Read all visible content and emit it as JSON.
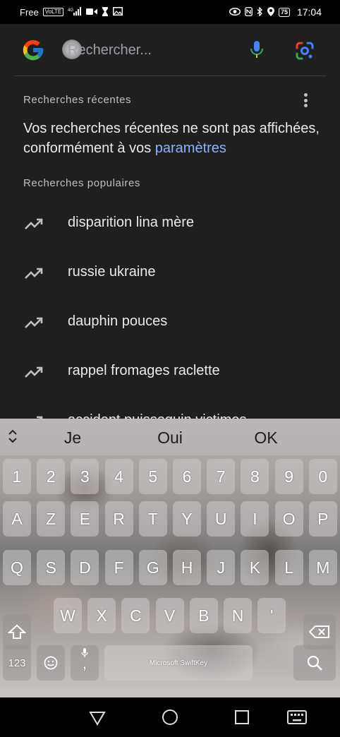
{
  "status_bar": {
    "carrier": "Free",
    "volte_badge": "VoLTE",
    "network_badge": "4G",
    "battery": "75",
    "time": "17:04"
  },
  "search": {
    "placeholder": "Rechercher..."
  },
  "recent": {
    "title": "Recherches récentes",
    "message_prefix": "Vos recherches récentes ne sont pas affichées, conformément à vos ",
    "message_link": "paramètres"
  },
  "popular": {
    "title": "Recherches populaires",
    "items": [
      {
        "label": "disparition lina mère"
      },
      {
        "label": "russie ukraine"
      },
      {
        "label": "dauphin pouces"
      },
      {
        "label": "rappel fromages raclette"
      },
      {
        "label": "accident puisseguin victimes"
      }
    ]
  },
  "keyboard": {
    "suggestions": [
      "Je",
      "Oui",
      "OK"
    ],
    "row_numbers": [
      "1",
      "2",
      "3",
      "4",
      "5",
      "6",
      "7",
      "8",
      "9",
      "0"
    ],
    "row1": [
      "A",
      "Z",
      "E",
      "R",
      "T",
      "Y",
      "U",
      "I",
      "O",
      "P"
    ],
    "row2": [
      "Q",
      "S",
      "D",
      "F",
      "G",
      "H",
      "J",
      "K",
      "L",
      "M"
    ],
    "row3": [
      "W",
      "X",
      "C",
      "V",
      "B",
      "N",
      "'"
    ],
    "symbols_key": "123",
    "comma_key": ",",
    "brand": "Microsoft SwiftKey"
  },
  "colors": {
    "background": "#1f1f20",
    "link": "#8ab4f8",
    "text": "#e8eaed"
  }
}
